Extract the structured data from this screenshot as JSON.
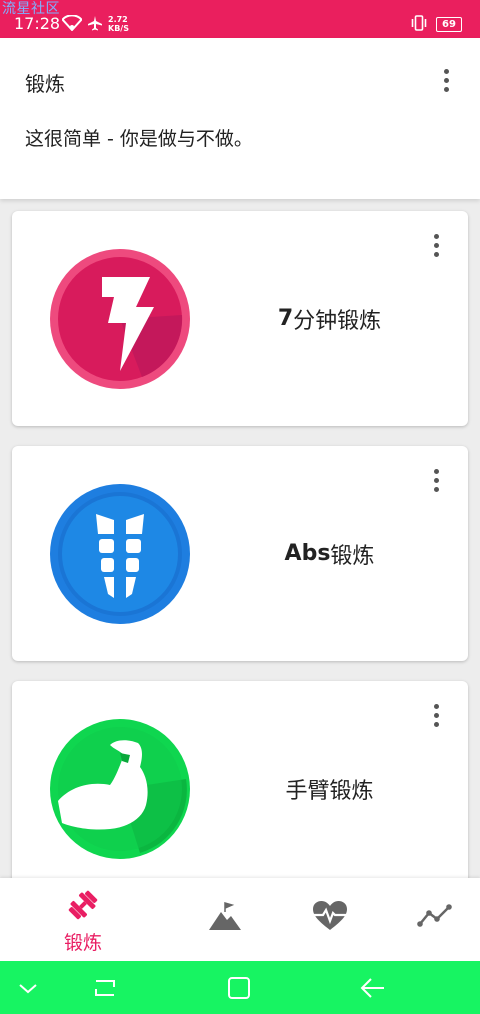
{
  "status_bar": {
    "watermark": "流星社区",
    "time": "17:28",
    "net_speed_value": "2.72",
    "net_speed_unit": "KB/S",
    "battery": "69",
    "background": "#ea1f5e"
  },
  "header": {
    "title": "锻炼",
    "subtitle": "这很简单 - 你是做与不做。"
  },
  "workouts": [
    {
      "label_bold": "7",
      "label_rest": "分钟锻炼",
      "icon": "lightning-icon",
      "color": "#e91e63"
    },
    {
      "label_bold": "Abs",
      "label_rest": "锻炼",
      "icon": "abs-icon",
      "color": "#1e7ee0"
    },
    {
      "label_bold": "",
      "label_rest": "手臂锻炼",
      "icon": "arm-icon",
      "color": "#0fd64f"
    }
  ],
  "bottom_nav": {
    "active_label": "锻炼",
    "items": [
      "dumbbell-icon",
      "mountain-flag-icon",
      "heart-pulse-icon",
      "trend-line-icon"
    ],
    "active_color": "#e91e63",
    "inactive_color": "#666666"
  },
  "system_nav": {
    "background": "#17f462",
    "buttons": [
      "chevron-down-icon",
      "recent-apps-icon",
      "home-square-icon",
      "back-arrow-icon"
    ]
  }
}
